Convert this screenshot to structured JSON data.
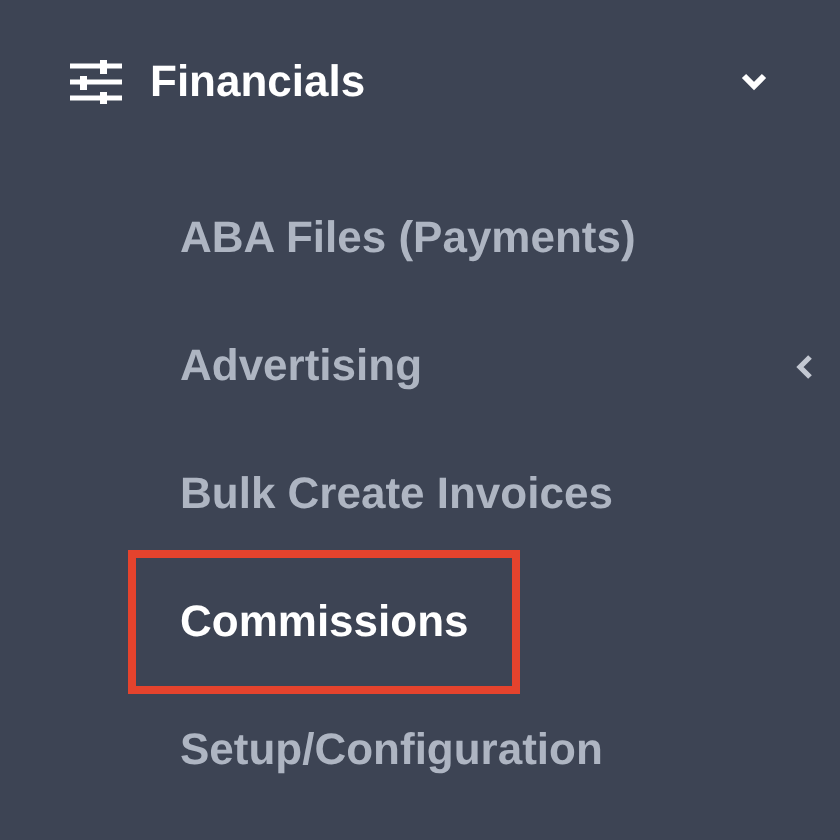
{
  "section": {
    "label": "Financials",
    "expanded": true
  },
  "items": [
    {
      "label": "ABA Files (Payments)",
      "selected": false,
      "highlighted": false,
      "has_submenu": false
    },
    {
      "label": "Advertising",
      "selected": false,
      "highlighted": false,
      "has_submenu": true
    },
    {
      "label": "Bulk Create Invoices",
      "selected": false,
      "highlighted": false,
      "has_submenu": false
    },
    {
      "label": "Commissions",
      "selected": true,
      "highlighted": true,
      "has_submenu": false
    },
    {
      "label": "Setup/Configuration",
      "selected": false,
      "highlighted": false,
      "has_submenu": false
    }
  ]
}
